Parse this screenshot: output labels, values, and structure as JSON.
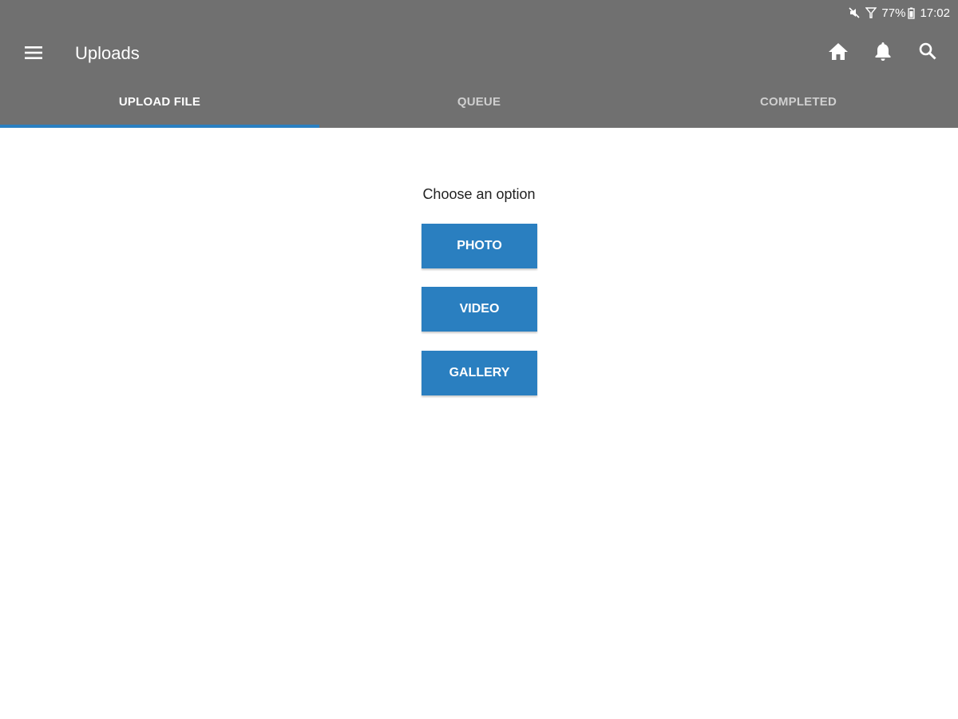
{
  "status_bar": {
    "battery": "77%",
    "time": "17:02",
    "icons": [
      "mute-icon",
      "signal-icon",
      "battery-icon"
    ]
  },
  "app_bar": {
    "title": "Uploads",
    "icons": [
      "menu-icon",
      "home-icon",
      "bell-icon",
      "search-icon"
    ]
  },
  "tabs": [
    {
      "label": "UPLOAD FILE",
      "active": true
    },
    {
      "label": "QUEUE",
      "active": false
    },
    {
      "label": "COMPLETED",
      "active": false
    }
  ],
  "main": {
    "prompt": "Choose an option",
    "options": [
      "PHOTO",
      "VIDEO",
      "GALLERY"
    ]
  },
  "colors": {
    "toolbar": "#707070",
    "accent": "#2a7fc0",
    "background": "#ffffff"
  }
}
